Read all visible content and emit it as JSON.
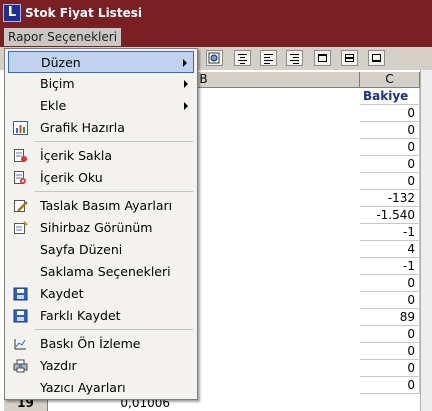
{
  "window": {
    "title": "Stok Fiyat Listesi",
    "app_icon_letter": "L"
  },
  "menubar": {
    "active_menu": "Rapor Seçenekleri"
  },
  "sheet": {
    "columns": [
      "B",
      "C"
    ],
    "c_header_text": "Bakiye",
    "c_values": [
      "0",
      "0",
      "0",
      "0",
      "0",
      "-132",
      "-1.540",
      "-1",
      "4",
      "-1",
      "0",
      "0",
      "89",
      "0",
      "0",
      "0",
      "0"
    ],
    "last_row_number": "19",
    "last_row_b_partial": "0,01006"
  },
  "menu": {
    "items": [
      {
        "label": "Düzen",
        "icon": "none",
        "submenu": true
      },
      {
        "label": "Biçim",
        "icon": "none",
        "submenu": true
      },
      {
        "label": "Ekle",
        "icon": "none",
        "submenu": true
      },
      {
        "label": "Grafik Hazırla",
        "icon": "chart-icon",
        "submenu": false
      },
      {
        "label": "İçerik Sakla",
        "icon": "hide-content-icon",
        "submenu": false
      },
      {
        "label": "İçerik Oku",
        "icon": "read-content-icon",
        "submenu": false
      },
      {
        "label": "Taslak Basım Ayarları",
        "icon": "draft-settings-icon",
        "submenu": false
      },
      {
        "label": "Sihirbaz Görünüm",
        "icon": "wizard-icon",
        "submenu": false
      },
      {
        "label": "Sayfa Düzeni",
        "icon": "none",
        "submenu": false
      },
      {
        "label": "Saklama Seçenekleri",
        "icon": "none",
        "submenu": false
      },
      {
        "label": "Kaydet",
        "icon": "save-icon",
        "submenu": false
      },
      {
        "label": "Farklı Kaydet",
        "icon": "save-as-icon",
        "submenu": false
      },
      {
        "label": "Baskı Ön İzleme",
        "icon": "print-preview-icon",
        "submenu": false
      },
      {
        "label": "Yazdır",
        "icon": "print-icon",
        "submenu": false
      },
      {
        "label": "Yazıcı Ayarları",
        "icon": "none",
        "submenu": false
      }
    ],
    "highlighted_item": "Düzen"
  },
  "colors": {
    "titlebar": "#7a1f22",
    "menu_highlight": "#c1d2ee",
    "header_text": "#1b2f8a"
  }
}
